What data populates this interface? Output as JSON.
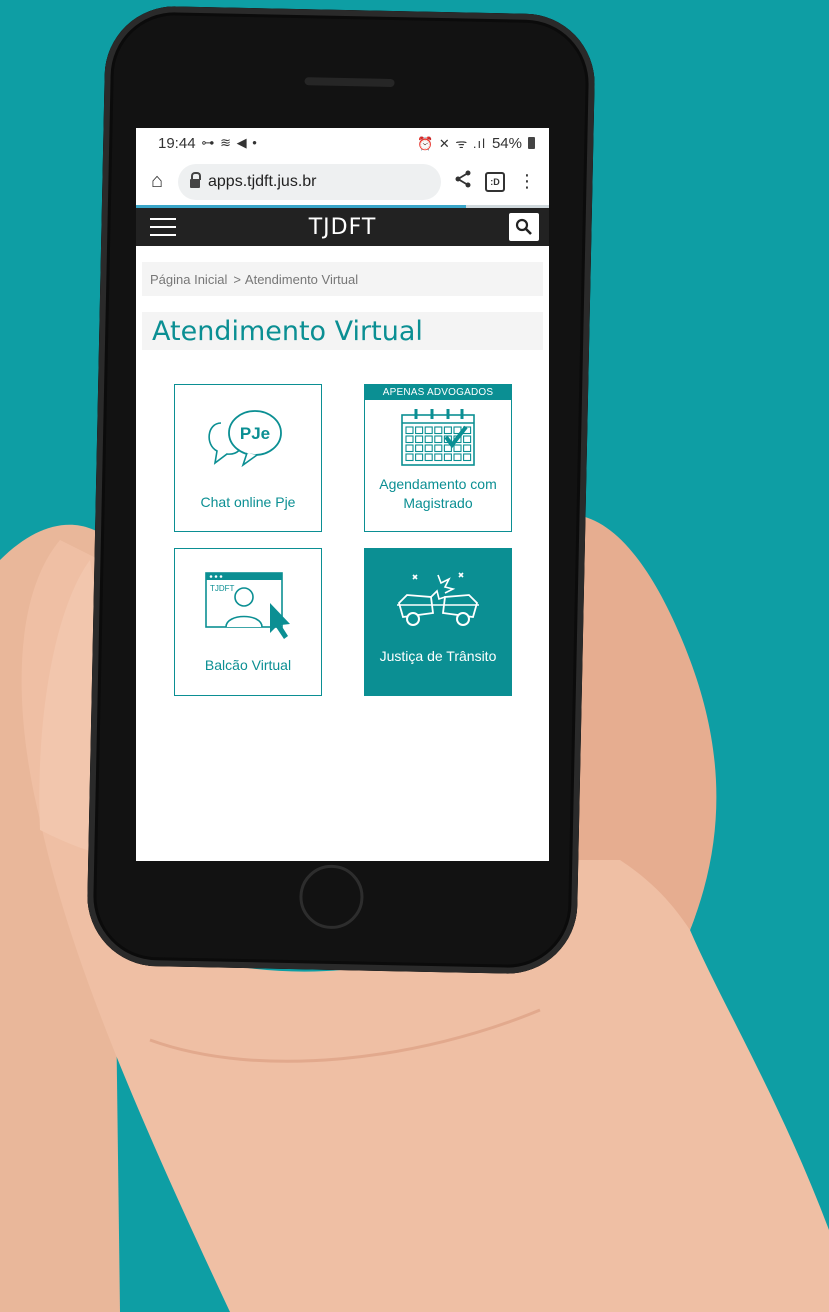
{
  "status_bar": {
    "time": "19:44",
    "left_icons": "⊶ ≋ ◀ •",
    "right_icons": "⏰ ✕ ᯤ .ıl",
    "battery": "54%"
  },
  "browser": {
    "url": "apps.tjdft.jus.br",
    "tabs_count": ":D"
  },
  "site": {
    "brand": "TJDFT"
  },
  "breadcrumb": {
    "home": "Página Inicial",
    "separator": ">",
    "current": "Atendimento Virtual"
  },
  "page": {
    "title": "Atendimento Virtual"
  },
  "tiles": [
    {
      "label": "Chat online Pje",
      "icon": "pje-chat-icon",
      "icon_text": "PJe"
    },
    {
      "label": "Agendamento com Magistrado",
      "icon": "calendar-check-icon",
      "badge": "APENAS ADVOGADOS"
    },
    {
      "label": "Balcão Virtual",
      "icon": "virtual-counter-icon",
      "icon_text": "TJDFT"
    },
    {
      "label": "Justiça de Trânsito",
      "icon": "car-crash-icon"
    }
  ],
  "colors": {
    "brand_teal": "#0b8f93",
    "background": "#0e9ea4",
    "header": "#222222"
  }
}
